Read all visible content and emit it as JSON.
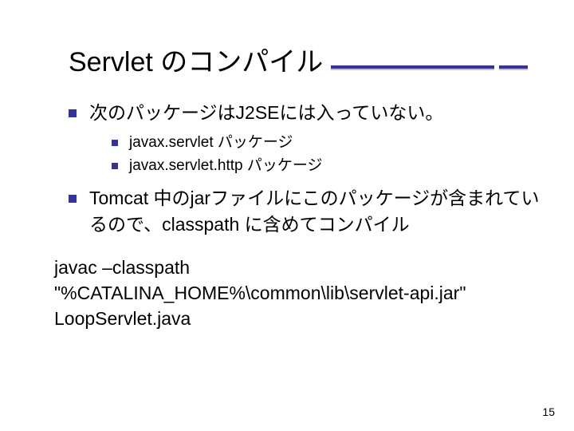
{
  "title": "Servlet のコンパイル",
  "bullets": {
    "lvl1": [
      {
        "text": "次のパッケージはJ2SEには入っていない。",
        "children": [
          "javax.servlet パッケージ",
          "javax.servlet.http パッケージ"
        ]
      },
      {
        "text": "Tomcat 中のjarファイルにこのパッケージが含まれているので、classpath に含めてコンパイル",
        "children": []
      }
    ]
  },
  "body_lines": [
    "javac –classpath",
    "\"%CATALINA_HOME%\\common\\lib\\servlet-api.jar\"",
    "LoopServlet.java"
  ],
  "page_number": "15"
}
